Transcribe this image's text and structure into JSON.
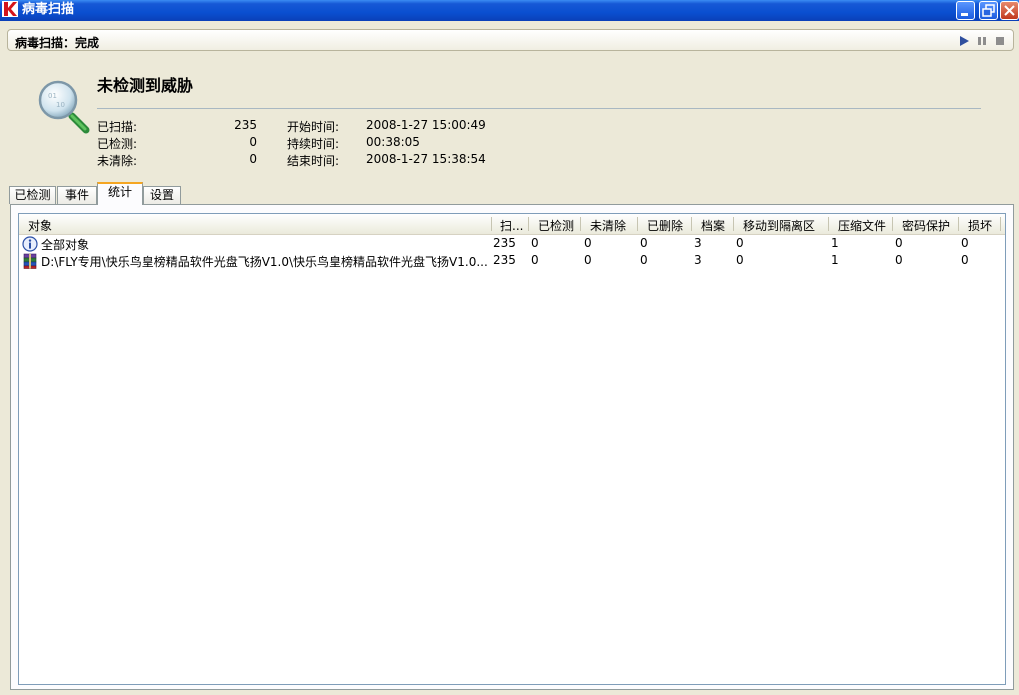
{
  "window": {
    "title": "病毒扫描"
  },
  "status_bar": {
    "label": "病毒扫描：完成"
  },
  "summary": {
    "headline": "未检测到威胁",
    "left_stats": [
      {
        "label": "已扫描:",
        "value": "235"
      },
      {
        "label": "已检测:",
        "value": "0"
      },
      {
        "label": "未清除:",
        "value": "0"
      }
    ],
    "right_stats": [
      {
        "label": "开始时间:",
        "value": "2008-1-27 15:00:49"
      },
      {
        "label": "持续时间:",
        "value": "00:38:05"
      },
      {
        "label": "结束时间:",
        "value": "2008-1-27 15:38:54"
      }
    ]
  },
  "tabs": [
    {
      "label": "已检测",
      "active": false
    },
    {
      "label": "事件",
      "active": false
    },
    {
      "label": "统计",
      "active": true
    },
    {
      "label": "设置",
      "active": false
    }
  ],
  "table": {
    "columns": [
      "对象",
      "扫...",
      "已检测",
      "未清除",
      "已删除",
      "档案",
      "移动到隔离区",
      "压缩文件",
      "密码保护",
      "损坏"
    ],
    "rows": [
      {
        "icon": "info-icon",
        "cells": [
          "全部对象",
          "235",
          "0",
          "0",
          "0",
          "3",
          "0",
          "1",
          "0",
          "0"
        ]
      },
      {
        "icon": "archive-icon",
        "cells": [
          "D:\\FLY专用\\快乐鸟皇榜精品软件光盘飞扬V1.0\\快乐鸟皇榜精品软件光盘飞扬V1.0...",
          "235",
          "0",
          "0",
          "0",
          "3",
          "0",
          "1",
          "0",
          "0"
        ]
      }
    ]
  },
  "colors": {
    "titlebar": "#0a4fd0",
    "tab_highlight": "#f5a622",
    "background": "#ece9d8"
  }
}
